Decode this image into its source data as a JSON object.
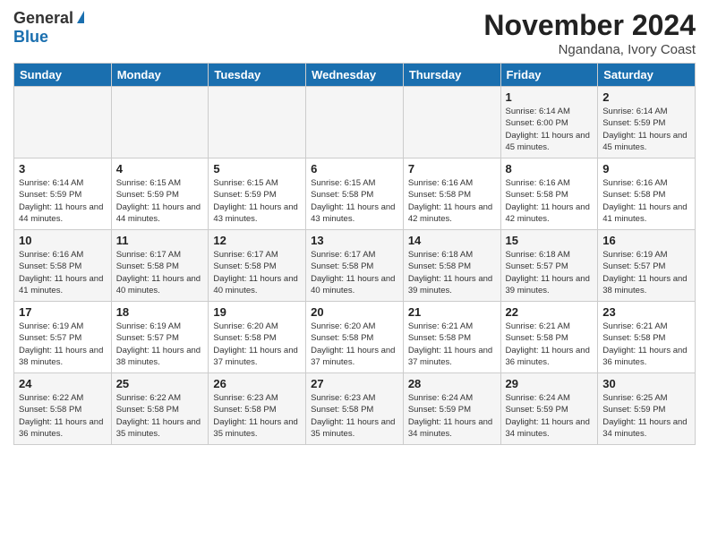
{
  "logo": {
    "general": "General",
    "blue": "Blue"
  },
  "header": {
    "month_title": "November 2024",
    "location": "Ngandana, Ivory Coast"
  },
  "days_of_week": [
    "Sunday",
    "Monday",
    "Tuesday",
    "Wednesday",
    "Thursday",
    "Friday",
    "Saturday"
  ],
  "weeks": [
    [
      {
        "day": "",
        "info": ""
      },
      {
        "day": "",
        "info": ""
      },
      {
        "day": "",
        "info": ""
      },
      {
        "day": "",
        "info": ""
      },
      {
        "day": "",
        "info": ""
      },
      {
        "day": "1",
        "info": "Sunrise: 6:14 AM\nSunset: 6:00 PM\nDaylight: 11 hours and 45 minutes."
      },
      {
        "day": "2",
        "info": "Sunrise: 6:14 AM\nSunset: 5:59 PM\nDaylight: 11 hours and 45 minutes."
      }
    ],
    [
      {
        "day": "3",
        "info": "Sunrise: 6:14 AM\nSunset: 5:59 PM\nDaylight: 11 hours and 44 minutes."
      },
      {
        "day": "4",
        "info": "Sunrise: 6:15 AM\nSunset: 5:59 PM\nDaylight: 11 hours and 44 minutes."
      },
      {
        "day": "5",
        "info": "Sunrise: 6:15 AM\nSunset: 5:59 PM\nDaylight: 11 hours and 43 minutes."
      },
      {
        "day": "6",
        "info": "Sunrise: 6:15 AM\nSunset: 5:58 PM\nDaylight: 11 hours and 43 minutes."
      },
      {
        "day": "7",
        "info": "Sunrise: 6:16 AM\nSunset: 5:58 PM\nDaylight: 11 hours and 42 minutes."
      },
      {
        "day": "8",
        "info": "Sunrise: 6:16 AM\nSunset: 5:58 PM\nDaylight: 11 hours and 42 minutes."
      },
      {
        "day": "9",
        "info": "Sunrise: 6:16 AM\nSunset: 5:58 PM\nDaylight: 11 hours and 41 minutes."
      }
    ],
    [
      {
        "day": "10",
        "info": "Sunrise: 6:16 AM\nSunset: 5:58 PM\nDaylight: 11 hours and 41 minutes."
      },
      {
        "day": "11",
        "info": "Sunrise: 6:17 AM\nSunset: 5:58 PM\nDaylight: 11 hours and 40 minutes."
      },
      {
        "day": "12",
        "info": "Sunrise: 6:17 AM\nSunset: 5:58 PM\nDaylight: 11 hours and 40 minutes."
      },
      {
        "day": "13",
        "info": "Sunrise: 6:17 AM\nSunset: 5:58 PM\nDaylight: 11 hours and 40 minutes."
      },
      {
        "day": "14",
        "info": "Sunrise: 6:18 AM\nSunset: 5:58 PM\nDaylight: 11 hours and 39 minutes."
      },
      {
        "day": "15",
        "info": "Sunrise: 6:18 AM\nSunset: 5:57 PM\nDaylight: 11 hours and 39 minutes."
      },
      {
        "day": "16",
        "info": "Sunrise: 6:19 AM\nSunset: 5:57 PM\nDaylight: 11 hours and 38 minutes."
      }
    ],
    [
      {
        "day": "17",
        "info": "Sunrise: 6:19 AM\nSunset: 5:57 PM\nDaylight: 11 hours and 38 minutes."
      },
      {
        "day": "18",
        "info": "Sunrise: 6:19 AM\nSunset: 5:57 PM\nDaylight: 11 hours and 38 minutes."
      },
      {
        "day": "19",
        "info": "Sunrise: 6:20 AM\nSunset: 5:58 PM\nDaylight: 11 hours and 37 minutes."
      },
      {
        "day": "20",
        "info": "Sunrise: 6:20 AM\nSunset: 5:58 PM\nDaylight: 11 hours and 37 minutes."
      },
      {
        "day": "21",
        "info": "Sunrise: 6:21 AM\nSunset: 5:58 PM\nDaylight: 11 hours and 37 minutes."
      },
      {
        "day": "22",
        "info": "Sunrise: 6:21 AM\nSunset: 5:58 PM\nDaylight: 11 hours and 36 minutes."
      },
      {
        "day": "23",
        "info": "Sunrise: 6:21 AM\nSunset: 5:58 PM\nDaylight: 11 hours and 36 minutes."
      }
    ],
    [
      {
        "day": "24",
        "info": "Sunrise: 6:22 AM\nSunset: 5:58 PM\nDaylight: 11 hours and 36 minutes."
      },
      {
        "day": "25",
        "info": "Sunrise: 6:22 AM\nSunset: 5:58 PM\nDaylight: 11 hours and 35 minutes."
      },
      {
        "day": "26",
        "info": "Sunrise: 6:23 AM\nSunset: 5:58 PM\nDaylight: 11 hours and 35 minutes."
      },
      {
        "day": "27",
        "info": "Sunrise: 6:23 AM\nSunset: 5:58 PM\nDaylight: 11 hours and 35 minutes."
      },
      {
        "day": "28",
        "info": "Sunrise: 6:24 AM\nSunset: 5:59 PM\nDaylight: 11 hours and 34 minutes."
      },
      {
        "day": "29",
        "info": "Sunrise: 6:24 AM\nSunset: 5:59 PM\nDaylight: 11 hours and 34 minutes."
      },
      {
        "day": "30",
        "info": "Sunrise: 6:25 AM\nSunset: 5:59 PM\nDaylight: 11 hours and 34 minutes."
      }
    ]
  ]
}
